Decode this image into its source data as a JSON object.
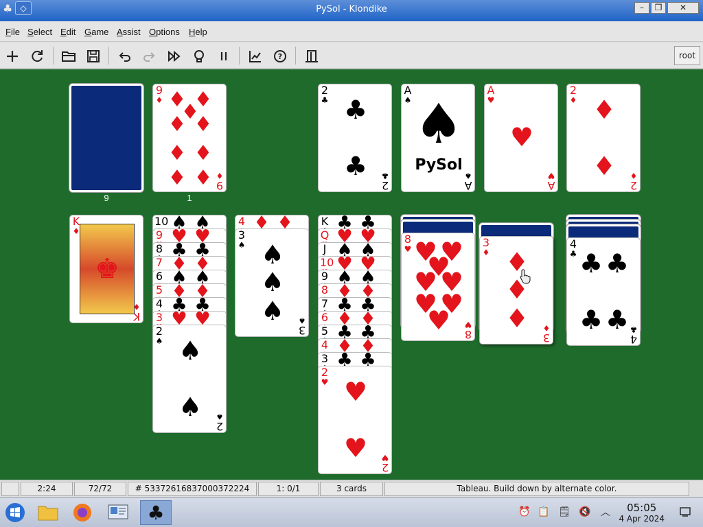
{
  "window": {
    "title": "PySol - Klondike",
    "app_icon": "club-icon",
    "controls": [
      "minimize-icon",
      "restore-icon",
      "close-icon"
    ]
  },
  "menu": [
    "File",
    "Select",
    "Edit",
    "Game",
    "Assist",
    "Options",
    "Help"
  ],
  "toolbar": {
    "buttons": [
      "new-game-icon",
      "restart-icon",
      "open-icon",
      "save-icon",
      "undo-icon",
      "redo-icon",
      "autodrop-icon",
      "hint-icon",
      "pause-icon",
      "statistics-icon",
      "rules-icon",
      "quit-icon"
    ],
    "user": "root"
  },
  "table": {
    "stock_count": "9",
    "waste_count": "1",
    "waste_card": {
      "rank": "9",
      "suit": "♦"
    },
    "foundations": [
      {
        "rank": "2",
        "suit": "♣"
      },
      {
        "rank": "A",
        "suit": "♠",
        "logo": "PySol"
      },
      {
        "rank": "A",
        "suit": "♥"
      },
      {
        "rank": "2",
        "suit": "♦"
      }
    ],
    "tableau": [
      {
        "cards": [
          {
            "rank": "K",
            "suit": "♦"
          }
        ]
      },
      {
        "cards": [
          {
            "rank": "10",
            "suit": "♠"
          },
          {
            "rank": "9",
            "suit": "♥"
          },
          {
            "rank": "8",
            "suit": "♣"
          },
          {
            "rank": "7",
            "suit": "♦"
          },
          {
            "rank": "6",
            "suit": "♠"
          },
          {
            "rank": "5",
            "suit": "♦"
          },
          {
            "rank": "4",
            "suit": "♣"
          },
          {
            "rank": "3",
            "suit": "♥"
          },
          {
            "rank": "2",
            "suit": "♠"
          }
        ]
      },
      {
        "cards": [
          {
            "rank": "4",
            "suit": "♦"
          },
          {
            "rank": "3",
            "suit": "♠"
          }
        ]
      },
      {
        "cards": [
          {
            "rank": "K",
            "suit": "♣"
          },
          {
            "rank": "Q",
            "suit": "♥"
          },
          {
            "rank": "J",
            "suit": "♠"
          },
          {
            "rank": "10",
            "suit": "♥"
          },
          {
            "rank": "9",
            "suit": "♠"
          },
          {
            "rank": "8",
            "suit": "♦"
          },
          {
            "rank": "7",
            "suit": "♣"
          },
          {
            "rank": "6",
            "suit": "♦"
          },
          {
            "rank": "5",
            "suit": "♣"
          },
          {
            "rank": "4",
            "suit": "♦"
          },
          {
            "rank": "3",
            "suit": "♣"
          },
          {
            "rank": "2",
            "suit": "♥"
          }
        ]
      },
      {
        "cards": [
          {
            "rank": "8",
            "suit": "♥"
          }
        ],
        "face_down": 2
      },
      {
        "cards": [
          {
            "rank": "3",
            "suit": "♦"
          }
        ],
        "face_down": 1,
        "dragging": true
      },
      {
        "cards": [
          {
            "rank": "4",
            "suit": "♣"
          }
        ],
        "face_down": 3
      }
    ]
  },
  "status": {
    "time": "2:24",
    "progress": "72/72",
    "game_number": "# 53372616837000372224",
    "moves": "1: 0/1",
    "cards": "3 cards",
    "hint": "Tableau. Build down by alternate color."
  },
  "taskbar": {
    "apps": [
      "start-icon",
      "file-manager-icon",
      "firefox-icon",
      "system-monitor-icon",
      "pysol-icon"
    ],
    "tray": [
      "alarm-icon",
      "clipboard-icon",
      "notes-icon",
      "mute-icon",
      "chevron-up-icon"
    ],
    "clock_time": "05:05",
    "clock_date": "4 Apr 2024",
    "show_desktop": "desktop-icon"
  }
}
